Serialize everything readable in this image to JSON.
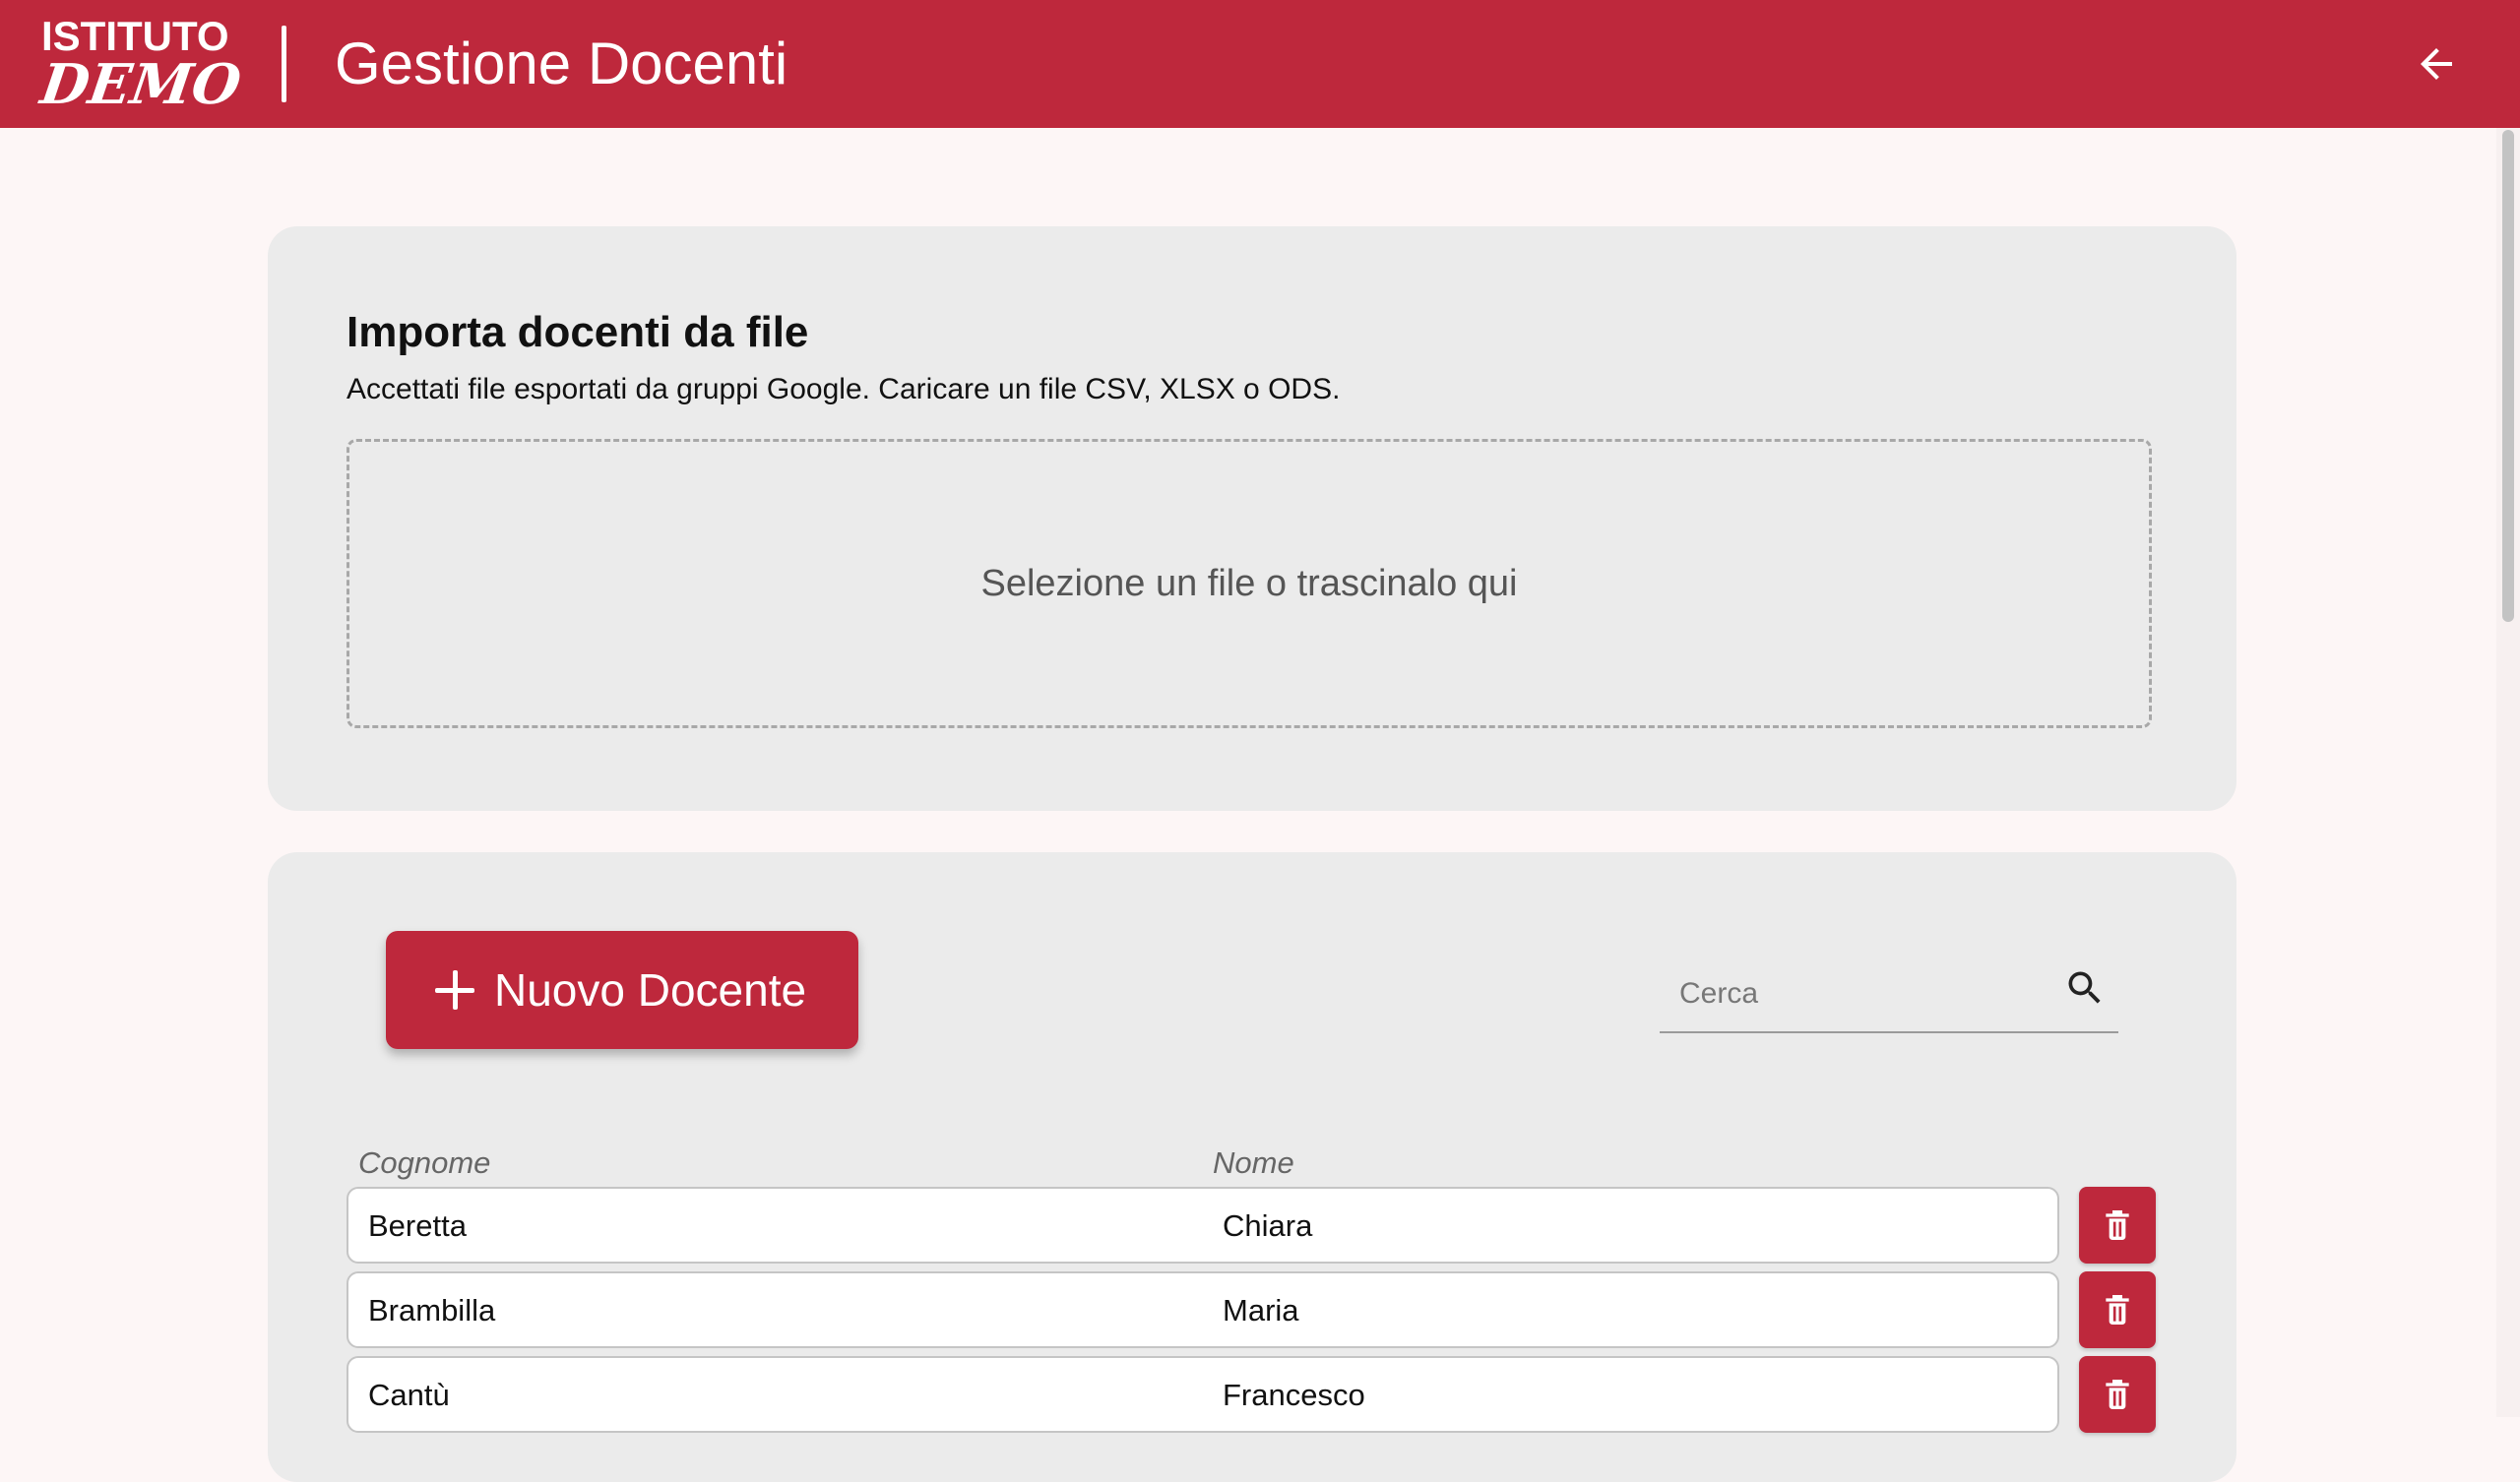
{
  "header": {
    "logo_line1": "ISTITUTO",
    "logo_line2": "DEMO",
    "title": "Gestione Docenti",
    "back_icon": "arrow-left-icon"
  },
  "colors": {
    "brand": "#be283c",
    "card_bg": "#ebebeb",
    "page_bg": "#fdf6f6"
  },
  "import_card": {
    "title": "Importa docenti da file",
    "subtitle": "Accettati file esportati da gruppi Google. Caricare un file CSV, XLSX o ODS.",
    "dropzone_text": "Selezione un file o trascinalo qui"
  },
  "list_card": {
    "new_button_label": "Nuovo Docente",
    "search_placeholder": "Cerca",
    "columns": [
      "Cognome",
      "Nome"
    ],
    "rows": [
      {
        "cognome": "Beretta",
        "nome": "Chiara"
      },
      {
        "cognome": "Brambilla",
        "nome": "Maria"
      },
      {
        "cognome": "Cantù",
        "nome": "Francesco"
      }
    ]
  }
}
